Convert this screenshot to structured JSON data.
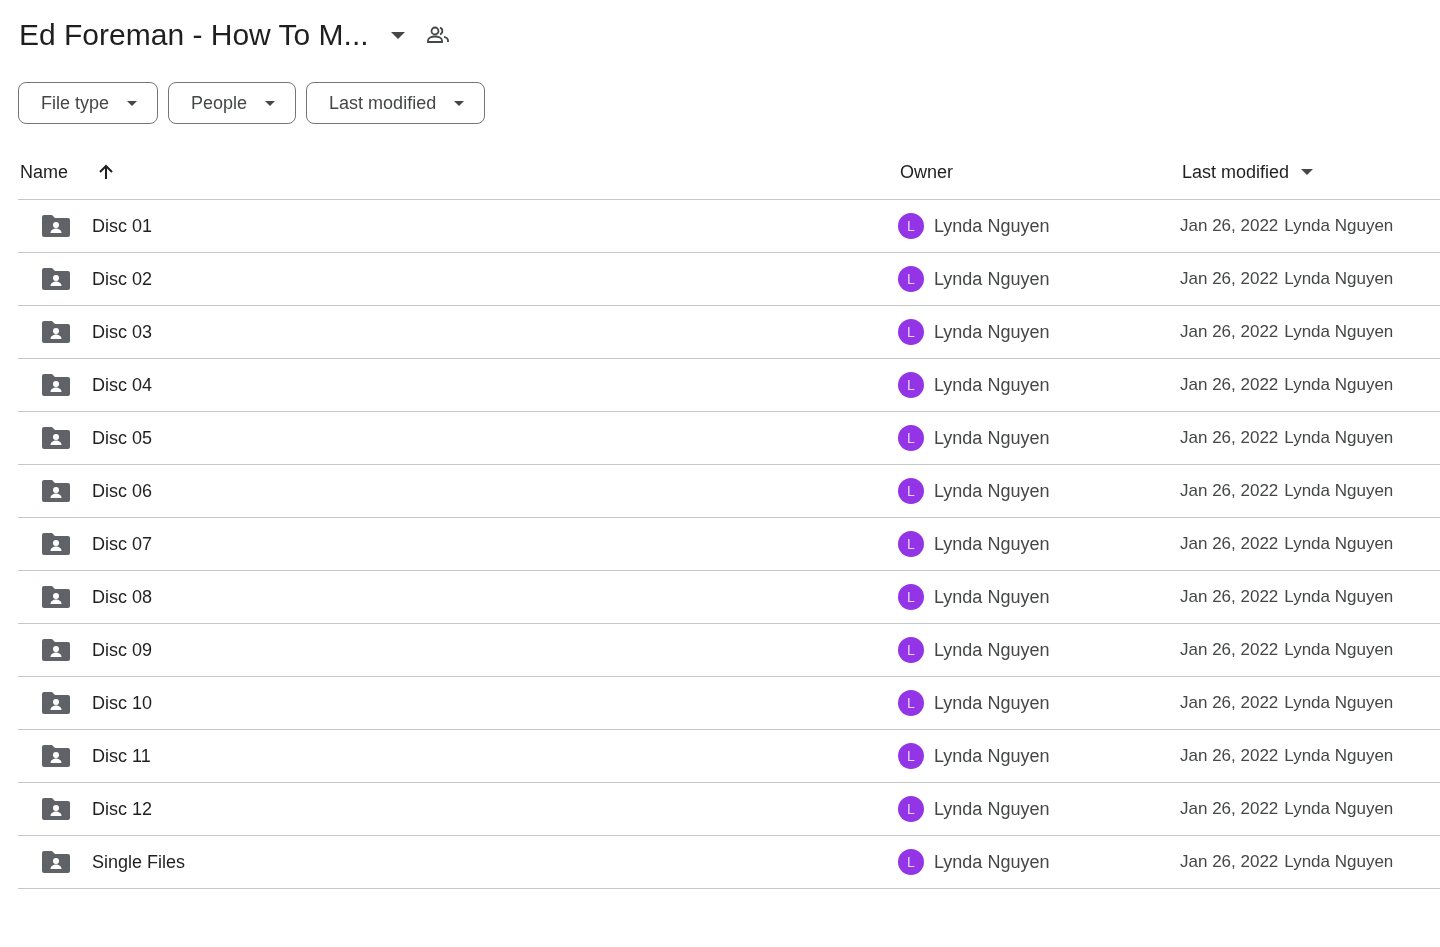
{
  "title": "Ed Foreman - How To M...",
  "filters": [
    {
      "label": "File type"
    },
    {
      "label": "People"
    },
    {
      "label": "Last modified"
    }
  ],
  "table": {
    "columns": [
      {
        "label": "Name",
        "sort_arrow": true,
        "menu": false
      },
      {
        "label": "Owner",
        "sort_arrow": false,
        "menu": false
      },
      {
        "label": "Last modified",
        "sort_arrow": false,
        "menu": true
      }
    ],
    "rows": [
      {
        "name": "Disc 01",
        "owner_initial": "L",
        "owner": "Lynda Nguyen",
        "modified_date": "Jan 26, 2022",
        "modified_by": "Lynda Nguyen"
      },
      {
        "name": "Disc 02",
        "owner_initial": "L",
        "owner": "Lynda Nguyen",
        "modified_date": "Jan 26, 2022",
        "modified_by": "Lynda Nguyen"
      },
      {
        "name": "Disc 03",
        "owner_initial": "L",
        "owner": "Lynda Nguyen",
        "modified_date": "Jan 26, 2022",
        "modified_by": "Lynda Nguyen"
      },
      {
        "name": "Disc 04",
        "owner_initial": "L",
        "owner": "Lynda Nguyen",
        "modified_date": "Jan 26, 2022",
        "modified_by": "Lynda Nguyen"
      },
      {
        "name": "Disc 05",
        "owner_initial": "L",
        "owner": "Lynda Nguyen",
        "modified_date": "Jan 26, 2022",
        "modified_by": "Lynda Nguyen"
      },
      {
        "name": "Disc 06",
        "owner_initial": "L",
        "owner": "Lynda Nguyen",
        "modified_date": "Jan 26, 2022",
        "modified_by": "Lynda Nguyen"
      },
      {
        "name": "Disc 07",
        "owner_initial": "L",
        "owner": "Lynda Nguyen",
        "modified_date": "Jan 26, 2022",
        "modified_by": "Lynda Nguyen"
      },
      {
        "name": "Disc 08",
        "owner_initial": "L",
        "owner": "Lynda Nguyen",
        "modified_date": "Jan 26, 2022",
        "modified_by": "Lynda Nguyen"
      },
      {
        "name": "Disc 09",
        "owner_initial": "L",
        "owner": "Lynda Nguyen",
        "modified_date": "Jan 26, 2022",
        "modified_by": "Lynda Nguyen"
      },
      {
        "name": "Disc 10",
        "owner_initial": "L",
        "owner": "Lynda Nguyen",
        "modified_date": "Jan 26, 2022",
        "modified_by": "Lynda Nguyen"
      },
      {
        "name": "Disc 11",
        "owner_initial": "L",
        "owner": "Lynda Nguyen",
        "modified_date": "Jan 26, 2022",
        "modified_by": "Lynda Nguyen"
      },
      {
        "name": "Disc 12",
        "owner_initial": "L",
        "owner": "Lynda Nguyen",
        "modified_date": "Jan 26, 2022",
        "modified_by": "Lynda Nguyen"
      },
      {
        "name": "Single Files",
        "owner_initial": "L",
        "owner": "Lynda Nguyen",
        "modified_date": "Jan 26, 2022",
        "modified_by": "Lynda Nguyen"
      }
    ]
  }
}
